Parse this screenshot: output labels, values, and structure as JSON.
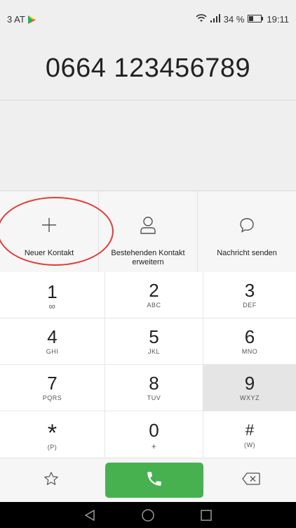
{
  "status_bar": {
    "carrier": "3 AT",
    "battery": "34 %",
    "time": "19:11"
  },
  "dial_display": {
    "number": "0664 123456789"
  },
  "actions": [
    {
      "label": "Neuer Kontakt",
      "icon": "plus-icon"
    },
    {
      "label": "Bestehenden Kontakt erweitern",
      "icon": "person-icon"
    },
    {
      "label": "Nachricht senden",
      "icon": "chat-bubble-icon"
    }
  ],
  "keypad": [
    {
      "digit": "1",
      "letters": "∞"
    },
    {
      "digit": "2",
      "letters": "ABC"
    },
    {
      "digit": "3",
      "letters": "DEF"
    },
    {
      "digit": "4",
      "letters": "GHI"
    },
    {
      "digit": "5",
      "letters": "JKL"
    },
    {
      "digit": "6",
      "letters": "MNO"
    },
    {
      "digit": "7",
      "letters": "PQRS"
    },
    {
      "digit": "8",
      "letters": "TUV"
    },
    {
      "digit": "9",
      "letters": "WXYZ"
    },
    {
      "digit": "*",
      "letters": "(P)"
    },
    {
      "digit": "0",
      "letters": "+"
    },
    {
      "digit": "#",
      "letters": "(W)"
    }
  ],
  "colors": {
    "call_green": "#47b14f",
    "highlight_red": "#e23b36"
  }
}
